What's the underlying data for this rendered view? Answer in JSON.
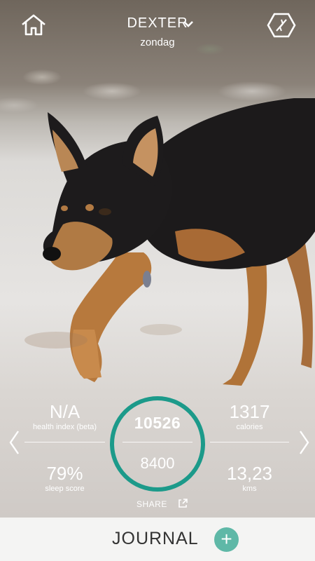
{
  "header": {
    "pet_name": "DEXTER",
    "day": "zondag"
  },
  "stats": {
    "health_index_value": "N/A",
    "health_index_label": "health index (beta)",
    "calories_value": "1317",
    "calories_label": "calories",
    "sleep_value": "79%",
    "sleep_label": "sleep score",
    "kms_value": "13,23",
    "kms_label": "kms",
    "activity_points": "10526",
    "activity_goal": "8400",
    "activity_progress_pct": 100
  },
  "share_label": "SHARE",
  "bottom": {
    "journal_label": "JOURNAL",
    "add_symbol": "+"
  },
  "colors": {
    "ring": "#1c9a8a",
    "add_button": "#5fb8a7",
    "bottom_bar": "#f4f4f3"
  },
  "icons": [
    "home-icon",
    "chevron-down-icon",
    "device-hexagon-icon",
    "chevron-left-icon",
    "chevron-right-icon",
    "external-link-icon",
    "plus-icon"
  ]
}
